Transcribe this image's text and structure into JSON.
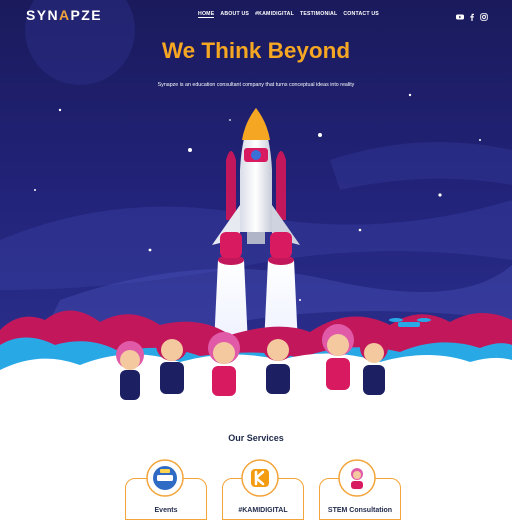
{
  "brand": {
    "logo_text": "SYNAPZE",
    "accent_color": "#f5a623",
    "navy_color": "#1c1f62"
  },
  "nav": {
    "items": [
      {
        "label": "HOME",
        "active": true
      },
      {
        "label": "ABOUT US",
        "active": false
      },
      {
        "label": "#KAMIDIGITAL",
        "active": false
      },
      {
        "label": "TESTIMONIAL",
        "active": false
      },
      {
        "label": "CONTACT US",
        "active": false
      }
    ],
    "social_icons": [
      "youtube-icon",
      "facebook-icon",
      "instagram-icon"
    ]
  },
  "hero": {
    "title": "We Think Beyond",
    "subtitle": "Synapze is an education consultant company that turns conceptual ideas into reality"
  },
  "services": {
    "heading": "Our Services",
    "cards": [
      {
        "label": "Events",
        "icon": "events-badge-icon"
      },
      {
        "label": "#KAMIDIGITAL",
        "icon": "kamidigital-k-icon"
      },
      {
        "label": "STEM Consultation",
        "icon": "stem-kids-icon"
      }
    ]
  }
}
